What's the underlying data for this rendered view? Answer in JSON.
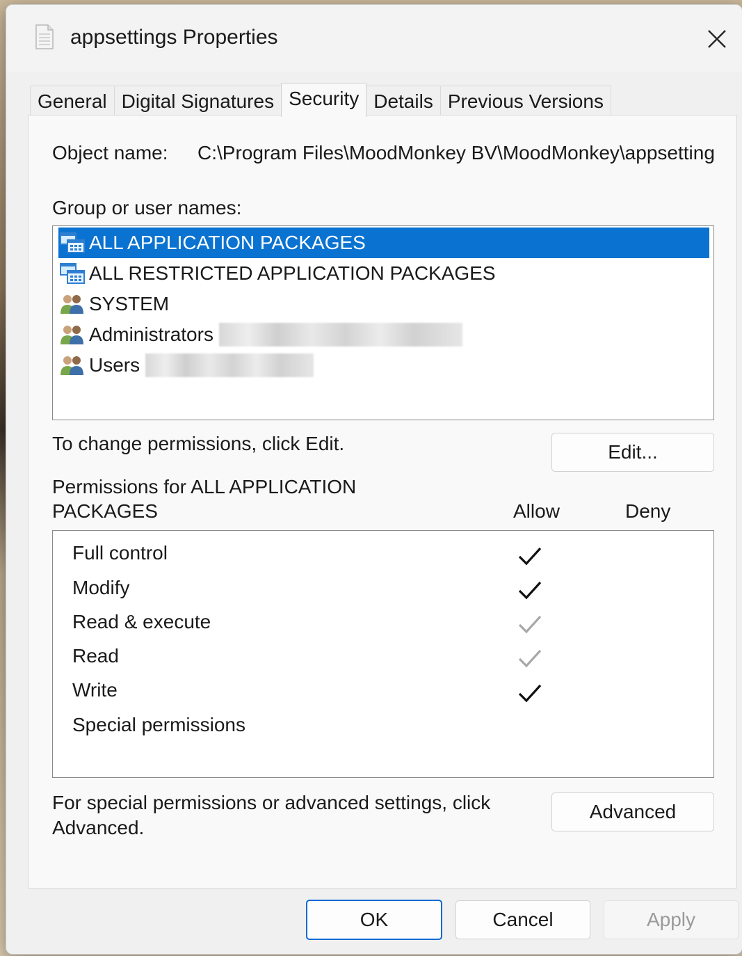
{
  "window": {
    "title": "appsettings Properties",
    "close_icon": "close-icon"
  },
  "tabs": [
    {
      "label": "General"
    },
    {
      "label": "Digital Signatures"
    },
    {
      "label": "Security",
      "active": true
    },
    {
      "label": "Details"
    },
    {
      "label": "Previous Versions"
    }
  ],
  "security": {
    "object_name_label": "Object name:",
    "object_name_value": "C:\\Program Files\\MoodMonkey BV\\MoodMonkey\\appsettings",
    "group_label": "Group or user names:",
    "principals": [
      {
        "name": "ALL APPLICATION PACKAGES",
        "icon": "app-package-icon",
        "selected": true
      },
      {
        "name": "ALL RESTRICTED APPLICATION PACKAGES",
        "icon": "app-package-icon"
      },
      {
        "name": "SYSTEM",
        "icon": "users-icon"
      },
      {
        "name": "Administrators",
        "icon": "users-icon"
      },
      {
        "name": "Users",
        "icon": "users-icon"
      }
    ],
    "change_text": "To change permissions, click Edit.",
    "edit_button": "Edit...",
    "permissions_for": "Permissions for ALL APPLICATION PACKAGES",
    "permissions_for_line1": "Permissions for ALL APPLICATION",
    "permissions_for_line2": "PACKAGES",
    "allow_header": "Allow",
    "deny_header": "Deny",
    "permissions": [
      {
        "name": "Full control",
        "allow": "checked",
        "deny": "none"
      },
      {
        "name": "Modify",
        "allow": "checked",
        "deny": "none"
      },
      {
        "name": "Read & execute",
        "allow": "inherited",
        "deny": "none"
      },
      {
        "name": "Read",
        "allow": "inherited",
        "deny": "none"
      },
      {
        "name": "Write",
        "allow": "checked",
        "deny": "none"
      },
      {
        "name": "Special permissions",
        "allow": "none",
        "deny": "none"
      }
    ],
    "advanced_text_line1": "For special permissions or advanced settings, click",
    "advanced_text_line2": "Advanced.",
    "advanced_button": "Advanced"
  },
  "footer": {
    "ok": "OK",
    "cancel": "Cancel",
    "apply": "Apply"
  },
  "colors": {
    "selection": "#0a73d1",
    "check_active": "#111111",
    "check_inherited": "#a8a8a8",
    "primary_border": "#0a6ad3"
  }
}
